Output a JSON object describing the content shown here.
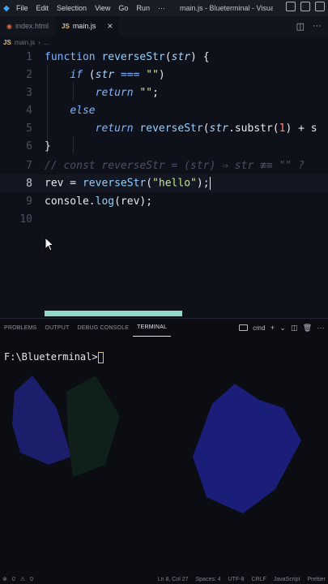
{
  "titlebar": {
    "menu": [
      "File",
      "Edit",
      "Selection",
      "View",
      "Go",
      "Run",
      "···"
    ],
    "title": "main.js - Blueterminal - Visual ..."
  },
  "tabs": [
    {
      "label": "index.html",
      "active": false
    },
    {
      "label": "main.js",
      "active": true
    }
  ],
  "breadcrumb": {
    "file": "main.js",
    "more": "..."
  },
  "editor": {
    "line_numbers": [
      "1",
      "2",
      "3",
      "4",
      "5",
      "6",
      "7",
      "8",
      "9",
      "10"
    ],
    "active_line": "8"
  },
  "panel": {
    "tabs": [
      "PROBLEMS",
      "OUTPUT",
      "DEBUG CONSOLE",
      "TERMINAL"
    ],
    "active_tab": "TERMINAL",
    "shell": "cmd",
    "prompt": "F:\\Blueterminal>"
  },
  "status": {
    "errors": "0",
    "warnings": "0",
    "position": "Ln 8, Col 27",
    "spaces": "Spaces: 4",
    "encoding": "UTF-8",
    "eol": "CRLF",
    "language": "JavaScript",
    "formatter": "Prettier"
  },
  "colors": {
    "background": "#0f111a",
    "keyword": "#7fb4ff",
    "string": "#c3e88d",
    "number": "#f78c6c",
    "scroll_thumb": "#8fd9c6"
  }
}
